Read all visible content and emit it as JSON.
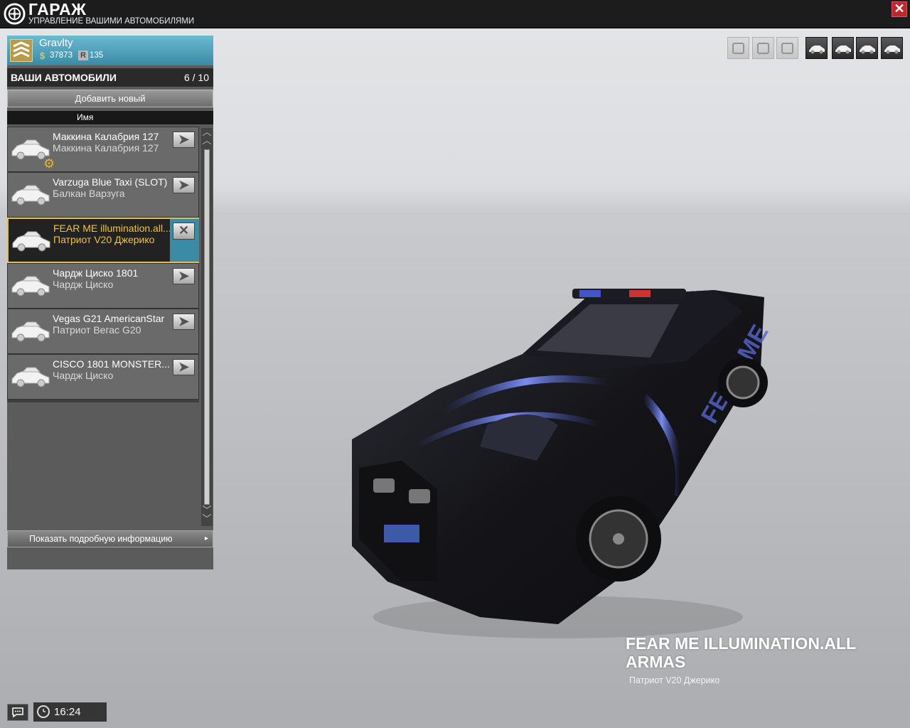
{
  "window": {
    "title": "ГАРАЖ",
    "subtitle": "УПРАВЛЕНИЕ ВАШИМИ АВТОМОБИЛЯМИ",
    "close_label": "✕"
  },
  "profile": {
    "name": "Gravlty",
    "credits": "37873",
    "rating_label": "R",
    "rating": "135"
  },
  "cars": {
    "title": "ВАШИ АВТОМОБИЛИ",
    "count": "6 / 10",
    "add_label": "Добавить новый",
    "column_name": "Имя",
    "items": [
      {
        "name": "Маккина Калабрия 127",
        "model": "Маккина Калабрия 127",
        "action": "➤",
        "selected": false,
        "gear": true
      },
      {
        "name": "Varzuga Blue Taxi (SLOT)",
        "model": "Балкан Варзуга",
        "action": "➤",
        "selected": false
      },
      {
        "name": "FEAR ME illumination.all...",
        "model": "Патриот V20 Джерико",
        "action": "✕",
        "selected": true
      },
      {
        "name": "Чардж Циско 1801",
        "model": "Чардж Циско",
        "action": "➤",
        "selected": false
      },
      {
        "name": "Vegas G21 AmericanStar",
        "model": "Патриот Вегас G20",
        "action": "➤",
        "selected": false
      },
      {
        "name": "CISCO 1801 MONSTER...",
        "model": "Чардж Циско",
        "action": "➤",
        "selected": false
      }
    ]
  },
  "details": {
    "label": "Показать подробную информацию",
    "arrow": "▸"
  },
  "view_buttons": [
    {
      "icon": "paint-icon",
      "active": false
    },
    {
      "icon": "engine-icon",
      "active": false
    },
    {
      "icon": "horn-icon",
      "active": false
    },
    {
      "icon": "car-iso-view-icon",
      "active": true
    },
    {
      "icon": "car-front-view-icon",
      "active": true
    },
    {
      "icon": "car-top-view-icon",
      "active": true
    },
    {
      "icon": "car-side-view-icon",
      "active": true
    }
  ],
  "selected_car": {
    "title": "FEAR ME ILLUMINATION.ALL ARMAS",
    "model": "Патриот V20 Джерико"
  },
  "status": {
    "time": "16:24"
  },
  "colors": {
    "accent": "#3b8aa6",
    "selected_text": "#f0c33a",
    "close": "#c0272d"
  }
}
